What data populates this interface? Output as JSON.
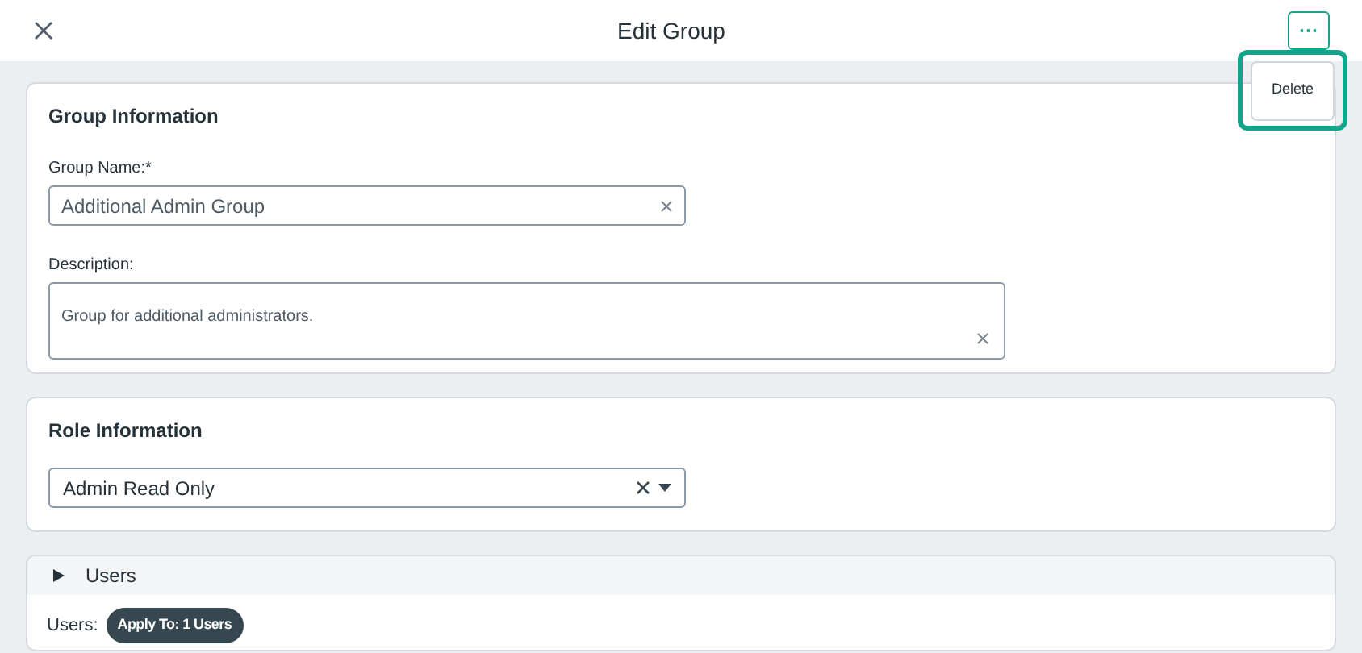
{
  "header": {
    "title": "Edit Group",
    "more_button": "···"
  },
  "menu": {
    "items": [
      "Delete"
    ]
  },
  "group_information": {
    "title": "Group Information",
    "name_label": "Group Name:*",
    "name_value": "Additional Admin Group",
    "description_label": "Description:",
    "description_value": "Group for additional administrators."
  },
  "role_information": {
    "title": "Role Information",
    "role_value": "Admin Read Only"
  },
  "users": {
    "title": "Users",
    "expanded": false,
    "label": "Users:",
    "badge": "Apply To: 1 Users"
  }
}
